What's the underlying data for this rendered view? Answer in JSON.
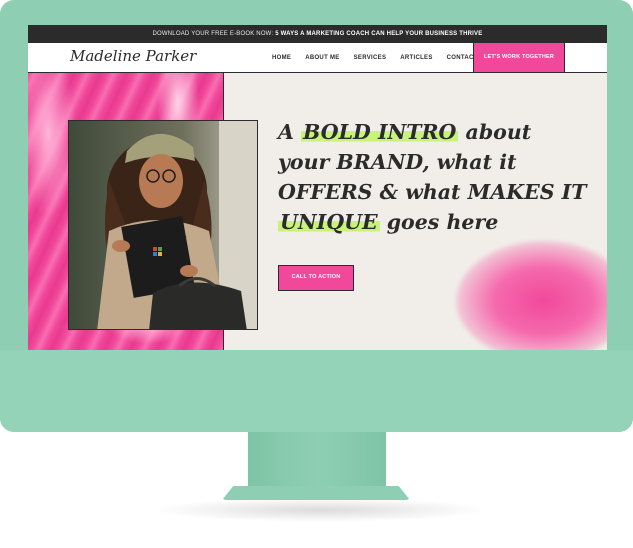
{
  "announcement": {
    "prefix": "DOWNLOAD YOUR FREE E-BOOK NOW: ",
    "highlight": "5 WAYS A MARKETING COACH CAN HELP YOUR BUSINESS THRIVE"
  },
  "header": {
    "logo": "Madeline Parker",
    "nav": [
      {
        "label": "HOME",
        "active": true
      },
      {
        "label": "ABOUT ME",
        "active": false
      },
      {
        "label": "SERVICES",
        "active": false
      },
      {
        "label": "ARTICLES",
        "active": false
      },
      {
        "label": "CONTACT",
        "active": false
      }
    ],
    "cta": "LET'S WORK TOGETHER"
  },
  "hero": {
    "headline_parts": [
      "A ",
      "BOLD INTRO",
      " about your BRAND, what it OFFERS & what MAKES IT ",
      "UNIQUE",
      " goes here"
    ],
    "cta": "CALL TO ACTION"
  },
  "colors": {
    "accent_pink": "#f1489b",
    "highlight_green": "#c8f27a",
    "monitor_mint": "#8ecfb3",
    "dark": "#2b2b2b",
    "background": "#f1eee9"
  },
  "icons": {
    "photo": "woman-with-laptop-photo"
  }
}
